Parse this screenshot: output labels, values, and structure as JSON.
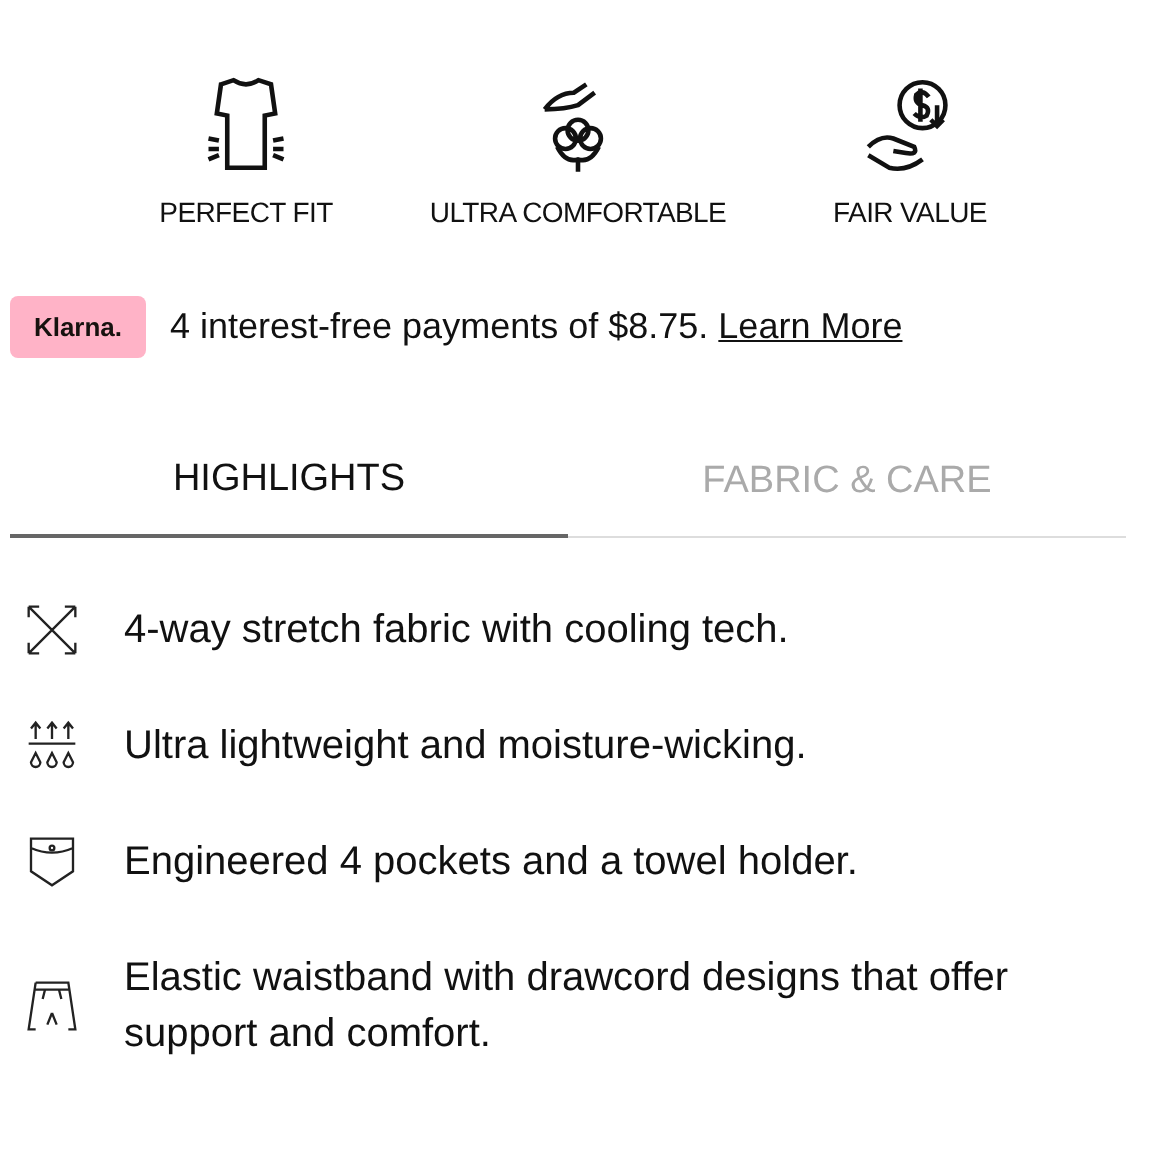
{
  "features": [
    {
      "label": "PERFECT FIT"
    },
    {
      "label": "ULTRA COMFORTABLE"
    },
    {
      "label": "FAIR VALUE"
    }
  ],
  "klarna": {
    "badge": "Klarna.",
    "text": "4 interest-free payments of $8.75.",
    "link": "Learn More"
  },
  "tabs": [
    {
      "label": "HIGHLIGHTS",
      "selected": true
    },
    {
      "label": "FABRIC & CARE",
      "selected": false
    }
  ],
  "highlights": [
    {
      "text": "4-way stretch fabric with cooling tech."
    },
    {
      "text": "Ultra lightweight and moisture-wicking."
    },
    {
      "text": "Engineered 4 pockets and a towel holder."
    },
    {
      "text": "Elastic waistband with drawcord designs that offer support and comfort."
    }
  ]
}
